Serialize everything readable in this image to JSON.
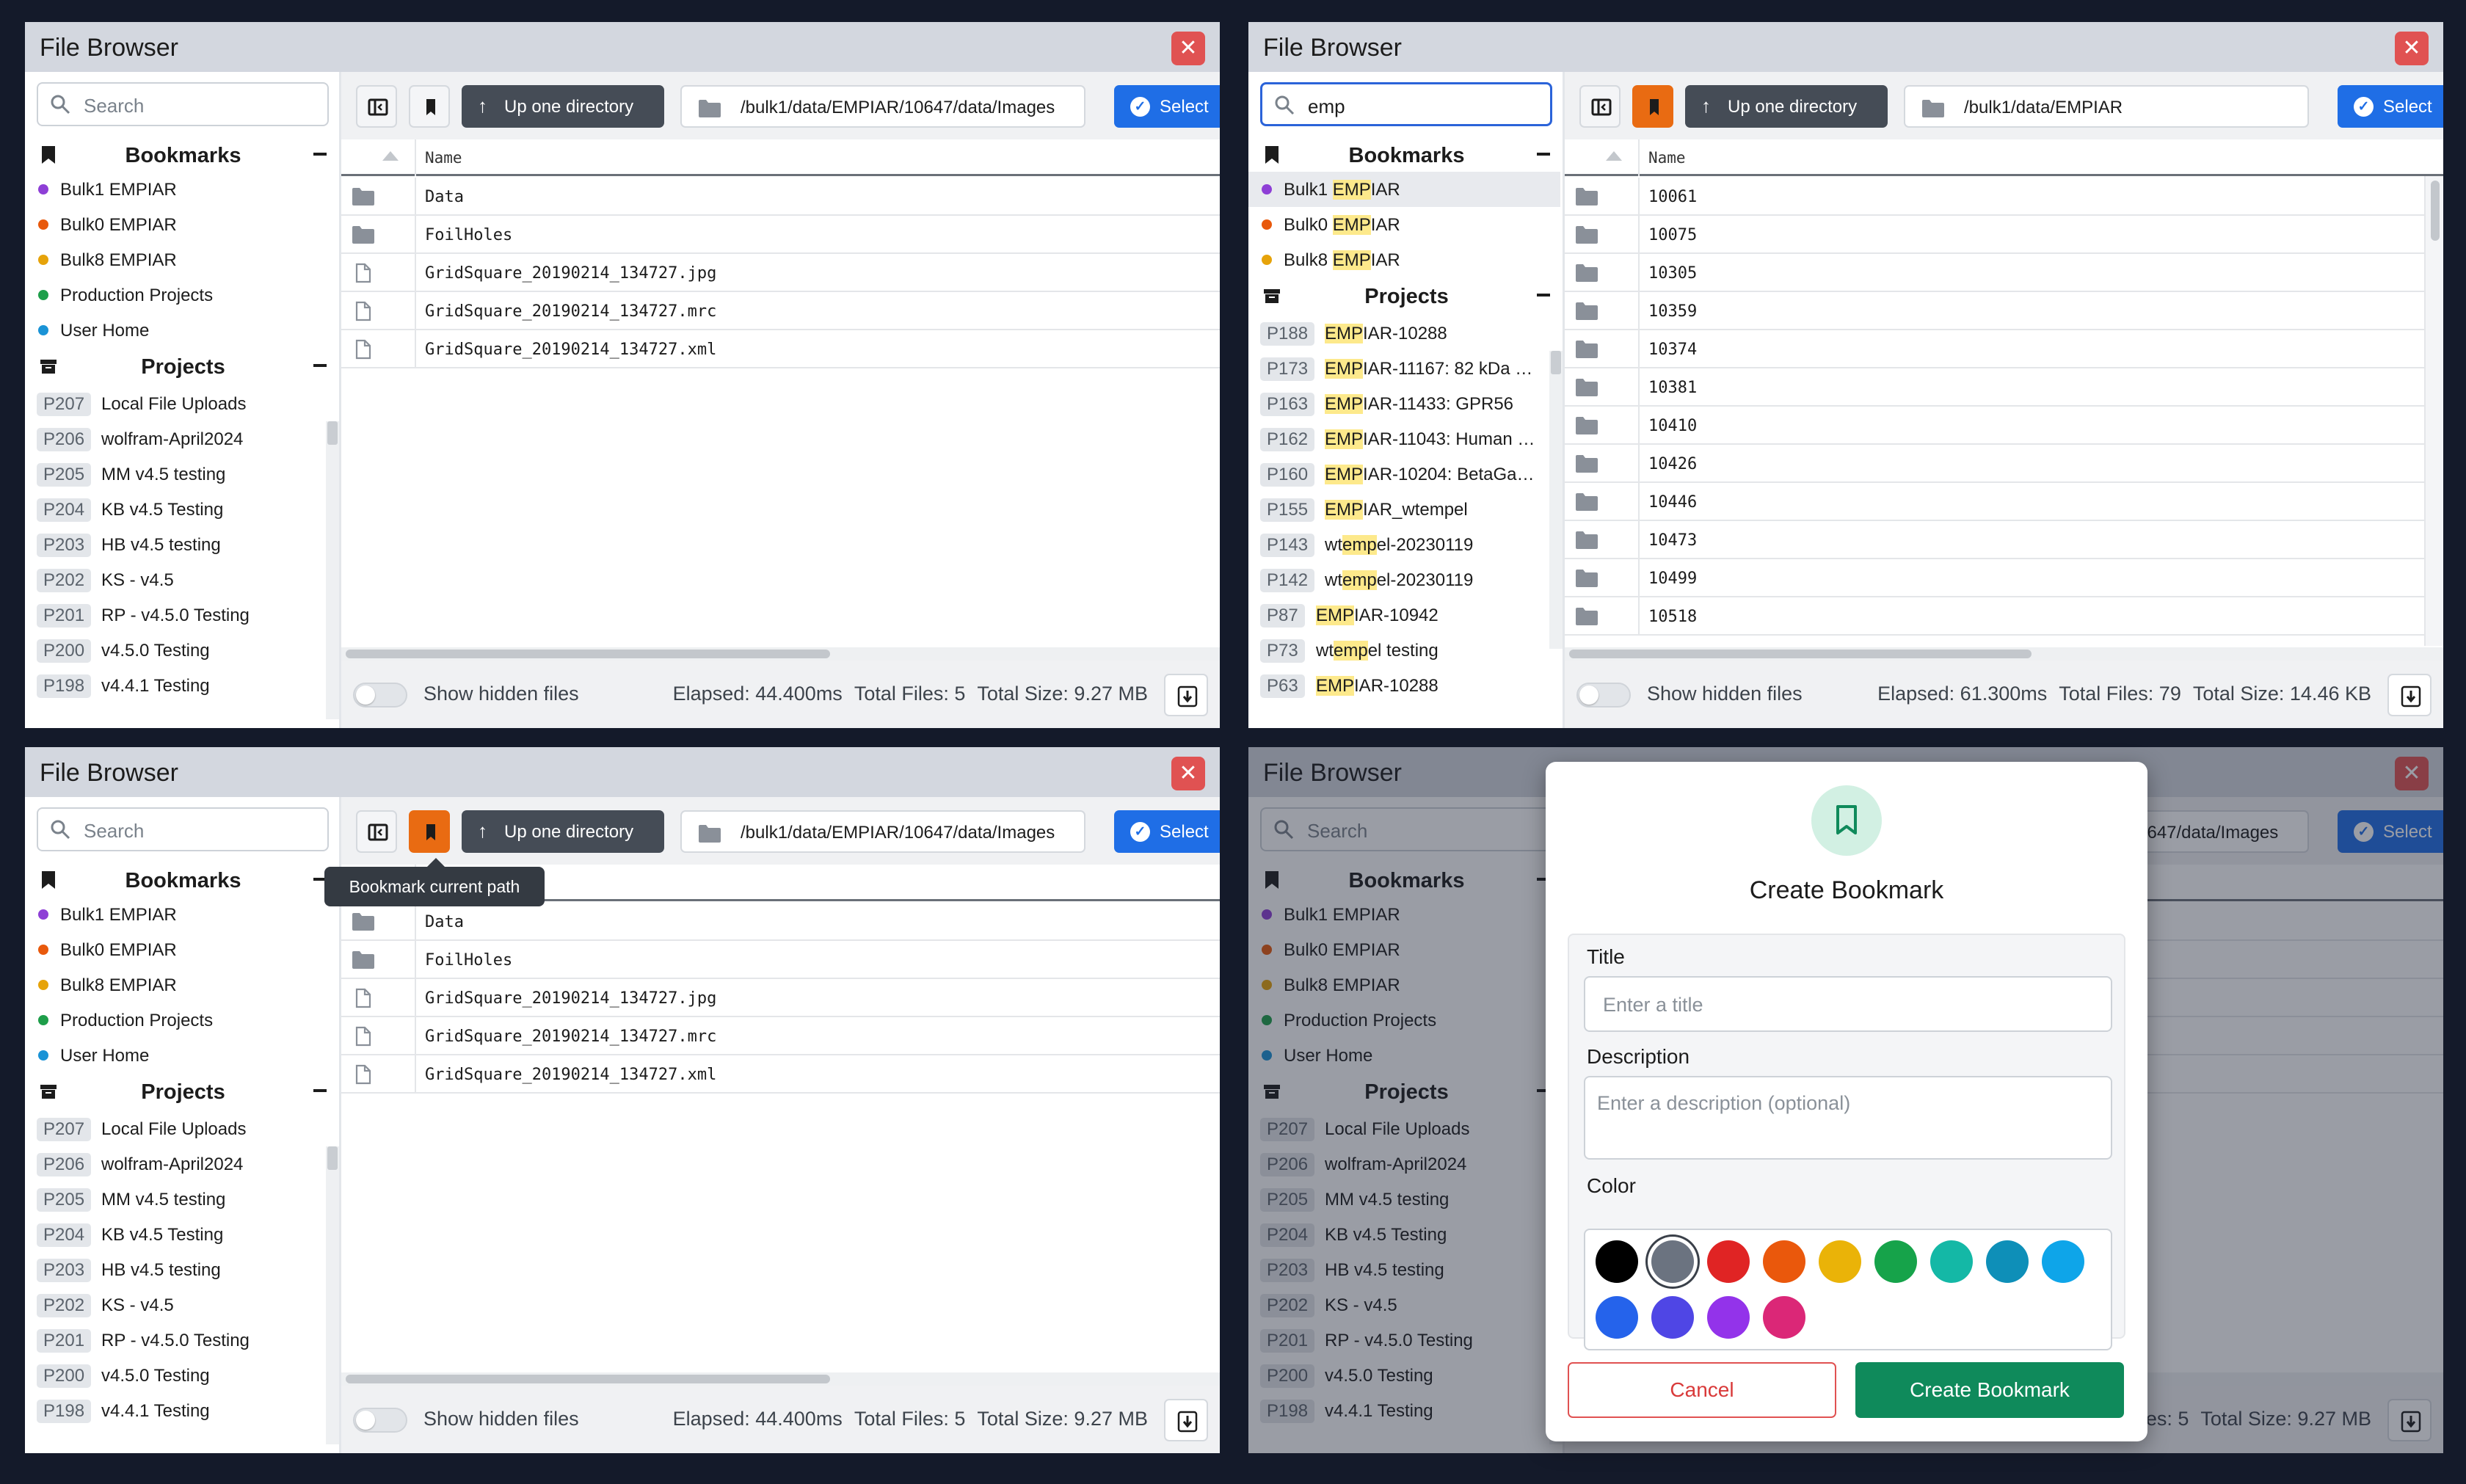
{
  "window_title": "File Browser",
  "search": {
    "placeholder": "Search",
    "query": "emp"
  },
  "sections": {
    "bookmarks": "Bookmarks",
    "projects": "Projects"
  },
  "bookmarks": [
    {
      "label": "Bulk1 EMPIAR",
      "color": "#8e3fd6"
    },
    {
      "label": "Bulk0 EMPIAR",
      "color": "#e8590c"
    },
    {
      "label": "Bulk8 EMPIAR",
      "color": "#e6a30a"
    },
    {
      "label": "Production Projects",
      "color": "#1e9e4a"
    },
    {
      "label": "User Home",
      "color": "#1a93d6"
    }
  ],
  "projects": [
    {
      "id": "P207",
      "name": "Local File Uploads"
    },
    {
      "id": "P206",
      "name": "wolfram-April2024"
    },
    {
      "id": "P205",
      "name": "MM v4.5 testing"
    },
    {
      "id": "P204",
      "name": "KB v4.5 Testing"
    },
    {
      "id": "P203",
      "name": "HB v4.5 testing"
    },
    {
      "id": "P202",
      "name": "KS - v4.5"
    },
    {
      "id": "P201",
      "name": "RP - v4.5.0 Testing"
    },
    {
      "id": "P200",
      "name": "v4.5.0 Testing"
    },
    {
      "id": "P198",
      "name": "v4.4.1 Testing"
    }
  ],
  "filtered_bookmarks": [
    {
      "pre": "Bulk1 ",
      "match": "EMP",
      "post": "IAR",
      "color": "#8e3fd6"
    },
    {
      "pre": "Bulk0 ",
      "match": "EMP",
      "post": "IAR",
      "color": "#e8590c"
    },
    {
      "pre": "Bulk8 ",
      "match": "EMP",
      "post": "IAR",
      "color": "#e6a30a"
    }
  ],
  "filtered_projects": [
    {
      "id": "P188",
      "pre": "",
      "match": "EMP",
      "post": "IAR-10288"
    },
    {
      "id": "P173",
      "pre": "",
      "match": "EMP",
      "post": "IAR-11167: 82 kDa m..."
    },
    {
      "id": "P163",
      "pre": "",
      "match": "EMP",
      "post": "IAR-11433: GPR56"
    },
    {
      "id": "P162",
      "pre": "",
      "match": "EMP",
      "post": "IAR-11043: Human e..."
    },
    {
      "id": "P160",
      "pre": "",
      "match": "EMP",
      "post": "IAR-10204: BetaGal ..."
    },
    {
      "id": "P155",
      "pre": "",
      "match": "EMP",
      "post": "IAR_wtempel"
    },
    {
      "id": "P143",
      "pre": "wt",
      "match": "emp",
      "post": "el-20230119"
    },
    {
      "id": "P142",
      "pre": "wt",
      "match": "emp",
      "post": "el-20230119"
    },
    {
      "id": "P87",
      "pre": "",
      "match": "EMP",
      "post": "IAR-10942"
    },
    {
      "id": "P73",
      "pre": "wt",
      "match": "emp",
      "post": "el testing"
    },
    {
      "id": "P63",
      "pre": "",
      "match": "EMP",
      "post": "IAR-10288"
    }
  ],
  "toolbar": {
    "up_label": "Up one directory",
    "select_label": "Select"
  },
  "path_a": "/bulk1/data/EMPIAR/10647/data/Images",
  "path_b": "/bulk1/data/EMPIAR",
  "column_name": "Name",
  "files_a": [
    {
      "name": "Data",
      "type": "folder"
    },
    {
      "name": "FoilHoles",
      "type": "folder"
    },
    {
      "name": "GridSquare_20190214_134727.jpg",
      "type": "file"
    },
    {
      "name": "GridSquare_20190214_134727.mrc",
      "type": "file"
    },
    {
      "name": "GridSquare_20190214_134727.xml",
      "type": "file"
    }
  ],
  "files_b": [
    "10061",
    "10075",
    "10305",
    "10359",
    "10374",
    "10381",
    "10410",
    "10426",
    "10446",
    "10473",
    "10499",
    "10518"
  ],
  "footer": {
    "hidden_label": "Show hidden files",
    "a": {
      "elapsed": "Elapsed: 44.400ms",
      "files": "Total Files: 5",
      "size": "Total Size: 9.27 MB"
    },
    "b": {
      "elapsed": "Elapsed: 61.300ms",
      "files": "Total Files: 79",
      "size": "Total Size: 14.46 KB"
    },
    "d_partial": "s: 5  Total Size: 9.27 MB"
  },
  "path_partial": "0647/data/Images",
  "tooltip": "Bookmark current path",
  "modal": {
    "title": "Create Bookmark",
    "title_label": "Title",
    "title_placeholder": "Enter a title",
    "description_label": "Description",
    "description_placeholder": "Enter a description (optional)",
    "color_label": "Color",
    "colors": [
      "#000000",
      "#6b7380",
      "#e02424",
      "#ea580c",
      "#eab308",
      "#16a34a",
      "#14b8a6",
      "#0e8fb8",
      "#0ea5e9",
      "#2563eb",
      "#4f46e5",
      "#9333ea",
      "#db2777"
    ],
    "selected_color": "#6b7380",
    "cancel": "Cancel",
    "create": "Create Bookmark"
  }
}
